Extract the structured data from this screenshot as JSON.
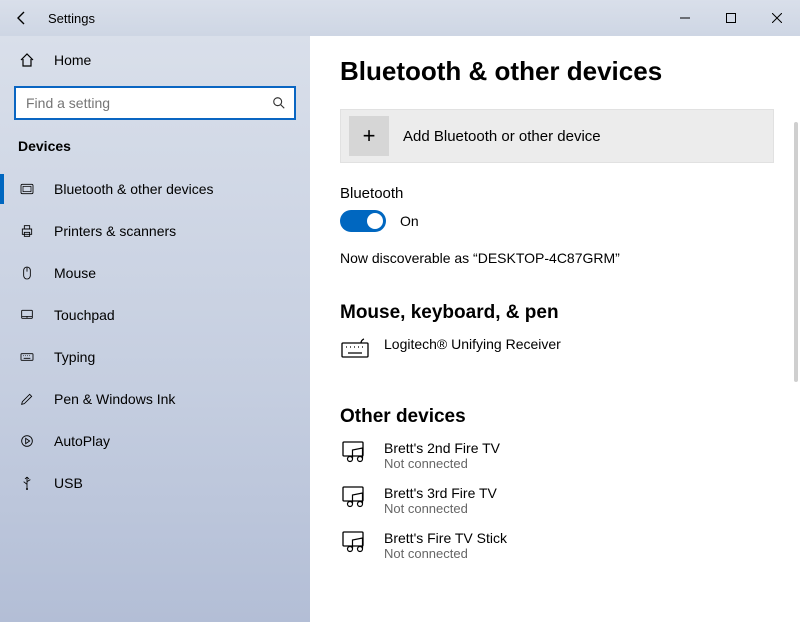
{
  "window": {
    "title": "Settings"
  },
  "sidebar": {
    "home_label": "Home",
    "search_placeholder": "Find a setting",
    "category": "Devices",
    "items": [
      {
        "label": "Bluetooth & other devices",
        "icon": "bluetooth-icon",
        "selected": true
      },
      {
        "label": "Printers & scanners",
        "icon": "printer-icon",
        "selected": false
      },
      {
        "label": "Mouse",
        "icon": "mouse-icon",
        "selected": false
      },
      {
        "label": "Touchpad",
        "icon": "touchpad-icon",
        "selected": false
      },
      {
        "label": "Typing",
        "icon": "keyboard-icon",
        "selected": false
      },
      {
        "label": "Pen & Windows Ink",
        "icon": "pen-icon",
        "selected": false
      },
      {
        "label": "AutoPlay",
        "icon": "autoplay-icon",
        "selected": false
      },
      {
        "label": "USB",
        "icon": "usb-icon",
        "selected": false
      }
    ]
  },
  "main": {
    "title": "Bluetooth & other devices",
    "add_label": "Add Bluetooth or other device",
    "bluetooth_label": "Bluetooth",
    "bluetooth_state": "On",
    "discoverable_text": "Now discoverable as “DESKTOP-4C87GRM”",
    "section_mkp": "Mouse, keyboard, & pen",
    "mkp_devices": [
      {
        "name": "Logitech® Unifying Receiver",
        "status": ""
      }
    ],
    "section_other": "Other devices",
    "other_devices": [
      {
        "name": "Brett's 2nd Fire TV",
        "status": "Not connected"
      },
      {
        "name": "Brett's 3rd Fire TV",
        "status": "Not connected"
      },
      {
        "name": "Brett's Fire TV Stick",
        "status": "Not connected"
      }
    ]
  },
  "colors": {
    "accent": "#0067c0"
  }
}
